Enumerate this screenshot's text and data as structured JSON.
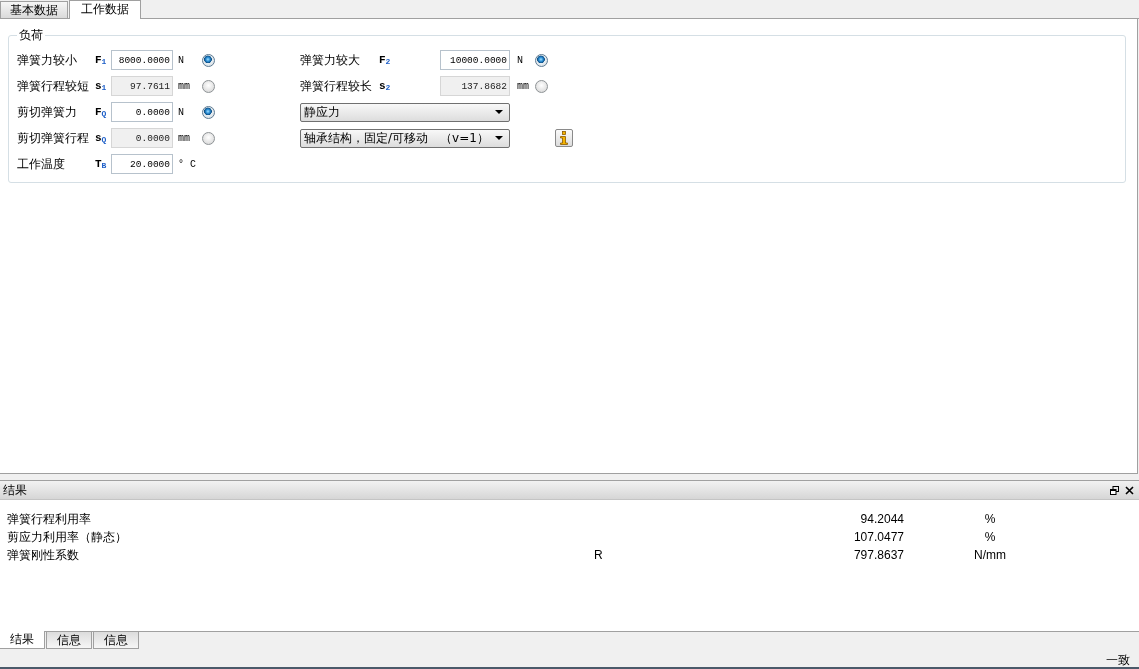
{
  "tabs": [
    {
      "label": "基本数据",
      "selected": false
    },
    {
      "label": "工作数据",
      "selected": true
    }
  ],
  "load": {
    "title": "负荷",
    "left_fields": [
      {
        "label": "弹簧力较小",
        "symbol": "F$_{1}$",
        "value": "8000.0000",
        "unit": "N",
        "kind": "radio",
        "disabled": false,
        "checked": true
      },
      {
        "label": "弹簧行程较短",
        "symbol": "s$_{1}$",
        "value": "97.7611",
        "unit": "mm",
        "kind": "radio",
        "disabled": true,
        "checked": false
      },
      {
        "label": "剪切弹簧力",
        "symbol": "F$_{Q}$",
        "value": "0.0000",
        "unit": "N",
        "kind": "radio",
        "disabled": false,
        "checked": true
      },
      {
        "label": "剪切弹簧行程",
        "symbol": "s$_{Q}$",
        "value": "0.0000",
        "unit": "mm",
        "kind": "radio",
        "disabled": true,
        "checked": false
      },
      {
        "label": "工作温度",
        "symbol": "T$_{B}$",
        "value": "20.0000",
        "unit": "° C",
        "kind": "plain",
        "disabled": false
      }
    ],
    "right_fields": [
      {
        "label": "弹簧力较大",
        "symbol": "F$_{2}$",
        "value": "10000.0000",
        "unit": "N",
        "kind": "radio",
        "disabled": false,
        "checked": true
      },
      {
        "label": "弹簧行程较长",
        "symbol": "s$_{2}$",
        "value": "137.8682",
        "unit": "mm",
        "kind": "radio",
        "disabled": true,
        "checked": false
      }
    ],
    "dropdowns": [
      {
        "value": "静应力",
        "info_button": false
      },
      {
        "value": "轴承结构，固定/可移动　（v=1）",
        "info_button": true
      }
    ]
  },
  "results": {
    "title": "结果",
    "rows": [
      {
        "label": "弹簧行程利用率",
        "value": "94.2044",
        "unit": "%"
      },
      {
        "label": "剪应力利用率（静态）",
        "value": "107.0477",
        "unit": "%"
      },
      {
        "label": "弹簧刚性系数",
        "symbol": "R",
        "value": "797.8637",
        "unit": "N/mm"
      }
    ]
  },
  "bottom_tabs": [
    {
      "label": "结果",
      "selected": true
    },
    {
      "label": "信息",
      "selected": false
    },
    {
      "label": "信息",
      "selected": false
    }
  ],
  "status_bar": {
    "text": "一致"
  }
}
